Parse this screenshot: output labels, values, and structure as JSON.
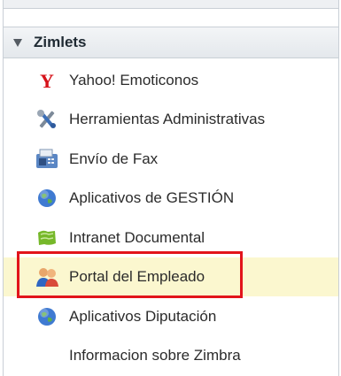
{
  "section": {
    "title": "Zimlets"
  },
  "items": [
    {
      "label": "Yahoo! Emoticonos",
      "icon": "yahoo-y-icon"
    },
    {
      "label": "Herramientas Administrativas",
      "icon": "tools-icon"
    },
    {
      "label": "Envío de Fax",
      "icon": "fax-icon"
    },
    {
      "label": "Aplicativos de GESTIÓN",
      "icon": "globe-icon"
    },
    {
      "label": "Intranet Documental",
      "icon": "green-document-icon"
    },
    {
      "label": "Portal del Empleado",
      "icon": "users-icon"
    },
    {
      "label": "Aplicativos Diputación",
      "icon": "globe-icon"
    },
    {
      "label": "Informacion sobre Zimbra",
      "icon": ""
    }
  ],
  "colors": {
    "highlight_border": "#e2141b",
    "selected_background": "#fbf7cf"
  }
}
